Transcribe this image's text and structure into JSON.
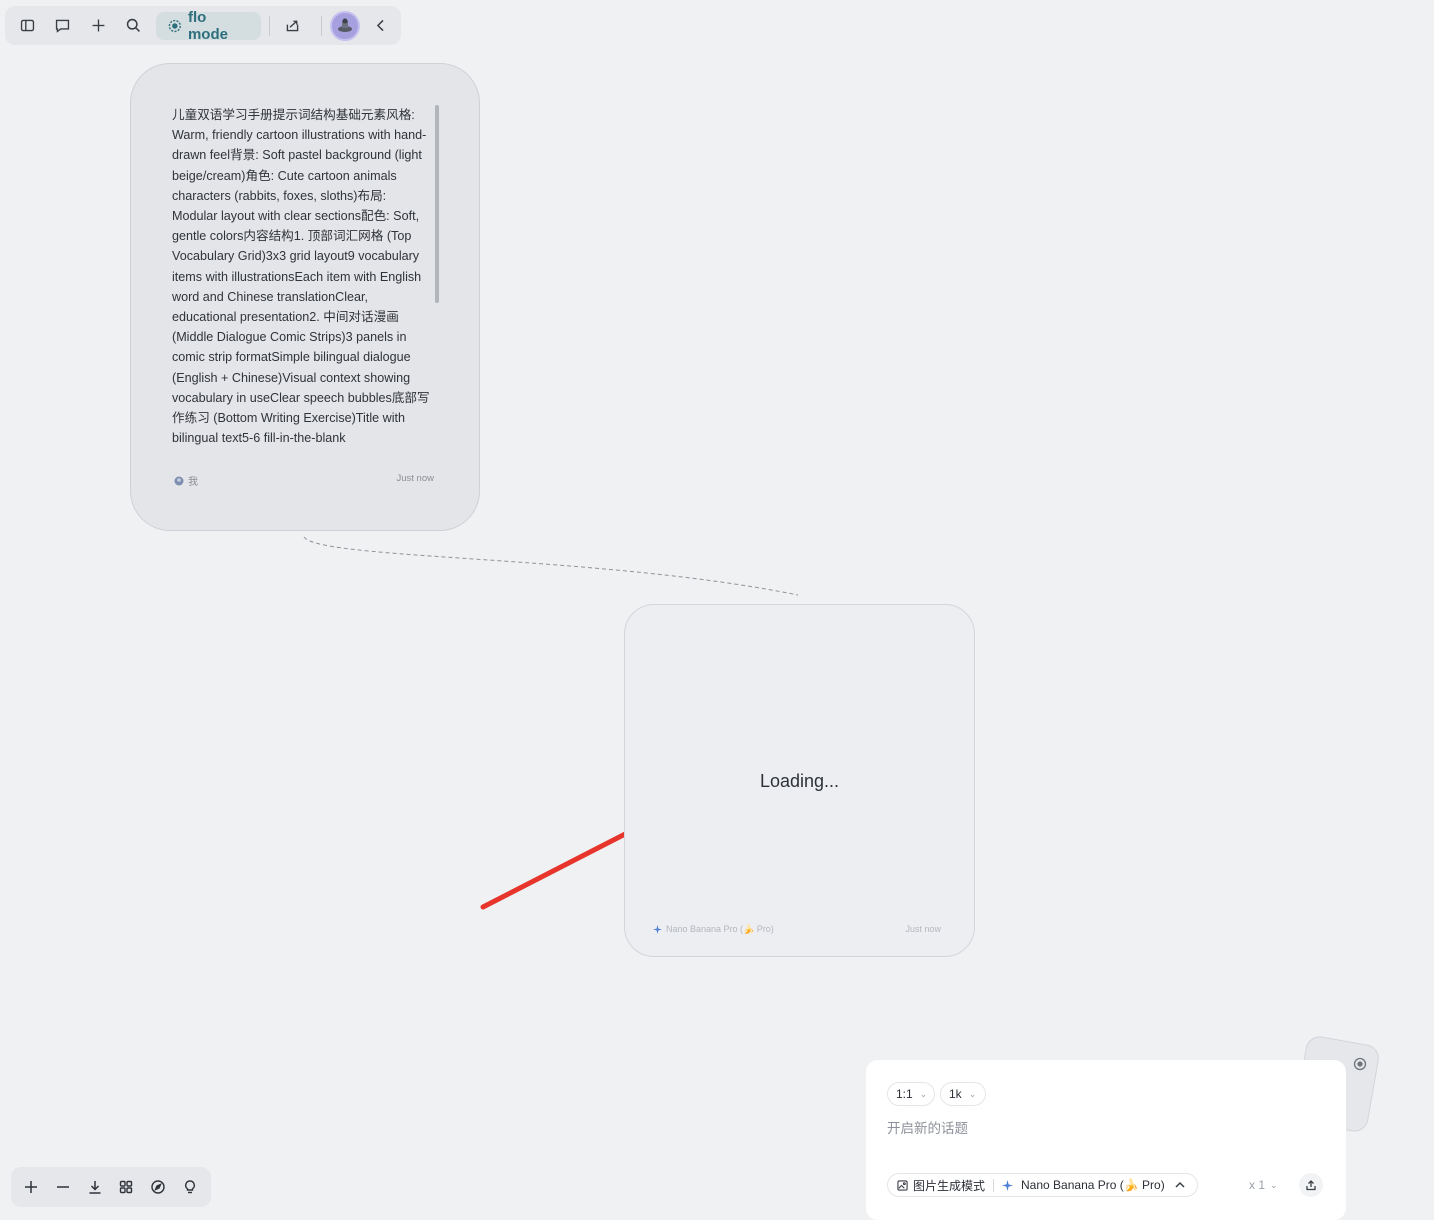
{
  "toolbar": {
    "flo_mode_label": "flo mode",
    "icons": [
      "sidebar-toggle-icon",
      "comment-icon",
      "plus-icon",
      "search-icon",
      "share-icon",
      "chevron-left-icon"
    ]
  },
  "prompt_card": {
    "text": "儿童双语学习手册提示词结构基础元素风格: Warm, friendly cartoon illustrations with hand-drawn feel背景: Soft pastel background (light beige/cream)角色: Cute cartoon animals characters (rabbits, foxes, sloths)布局: Modular layout with clear sections配色: Soft, gentle colors内容结构1. 顶部词汇网格 (Top Vocabulary Grid)3x3 grid layout9 vocabulary items with illustrationsEach item with English word and Chinese translationClear, educational presentation2. 中间对话漫画 (Middle Dialogue Comic Strips)3 panels in comic strip formatSimple bilingual dialogue (English + Chinese)Visual context showing vocabulary in useClear speech bubbles底部写作练习 (Bottom Writing Exercise)Title with bilingual text5-6 fill-in-the-blank",
    "author": "我",
    "time": "Just now"
  },
  "loading_card": {
    "status": "Loading...",
    "model": "Nano Banana Pro (🍌 Pro)",
    "time": "Just now"
  },
  "composer": {
    "aspect_ratio": "1:1",
    "resolution": "1k",
    "placeholder": "开启新的话题",
    "mode_label": "图片生成模式",
    "model_label": "Nano Banana Pro (🍌 Pro)",
    "count": "x 1"
  },
  "bottom_bar": {
    "icons": [
      "zoom-in-icon",
      "zoom-out-icon",
      "download-icon",
      "grid-icon",
      "compass-icon",
      "lightbulb-icon"
    ]
  },
  "colors": {
    "accent": "#2e6f7d",
    "annotation_arrow": "#e8352b",
    "canvas": "#f0f1f3"
  }
}
